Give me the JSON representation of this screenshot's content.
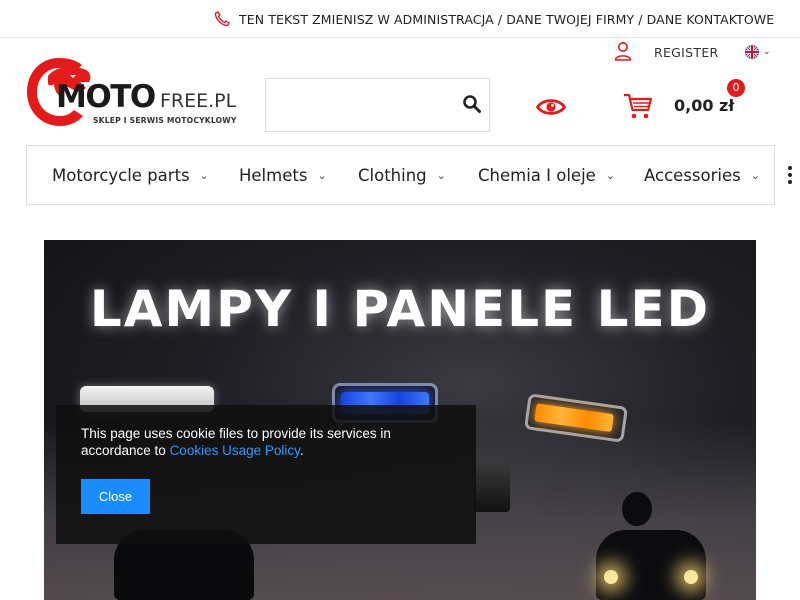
{
  "topbar": {
    "contact_text": "TEN TEKST ZMIENISZ W ADMINISTRACJA / DANE TWOJEJ FIRMY / DANE KONTAKTOWE",
    "phone_icon": "phone-icon"
  },
  "account": {
    "user_icon": "user-icon",
    "register_label": "REGISTER",
    "language_icon": "uk-flag-icon"
  },
  "logo": {
    "brand_bold": "MOTO",
    "brand_light": "FREE.PL",
    "tagline": "SKLEP I SERWIS MOTOCYKLOWY",
    "emblem_icon": "eagle-head-logo"
  },
  "search": {
    "placeholder": "",
    "value": "",
    "button_icon": "search-icon"
  },
  "header_actions": {
    "eye_icon": "eye-icon",
    "cart_icon": "cart-icon",
    "cart_total": "0,00 zł",
    "cart_count": "0"
  },
  "nav": {
    "items": [
      {
        "label": "Motorcycle parts"
      },
      {
        "label": "Helmets"
      },
      {
        "label": "Clothing"
      },
      {
        "label": "Chemia I oleje"
      },
      {
        "label": "Accessories"
      }
    ],
    "more_icon": "more-vertical-icon"
  },
  "banner": {
    "headline": "LAMPY I PANELE LED"
  },
  "cookie": {
    "text_before": "This page uses cookie files to provide its services in accordance to ",
    "link_text": "Cookies Usage Policy",
    "text_after": ".",
    "close_label": "Close"
  },
  "colors": {
    "brand_red": "#e41b1b",
    "link_blue": "#2e9bff",
    "button_blue": "#1a8cff",
    "cookie_bg": "#0f0f0f"
  }
}
